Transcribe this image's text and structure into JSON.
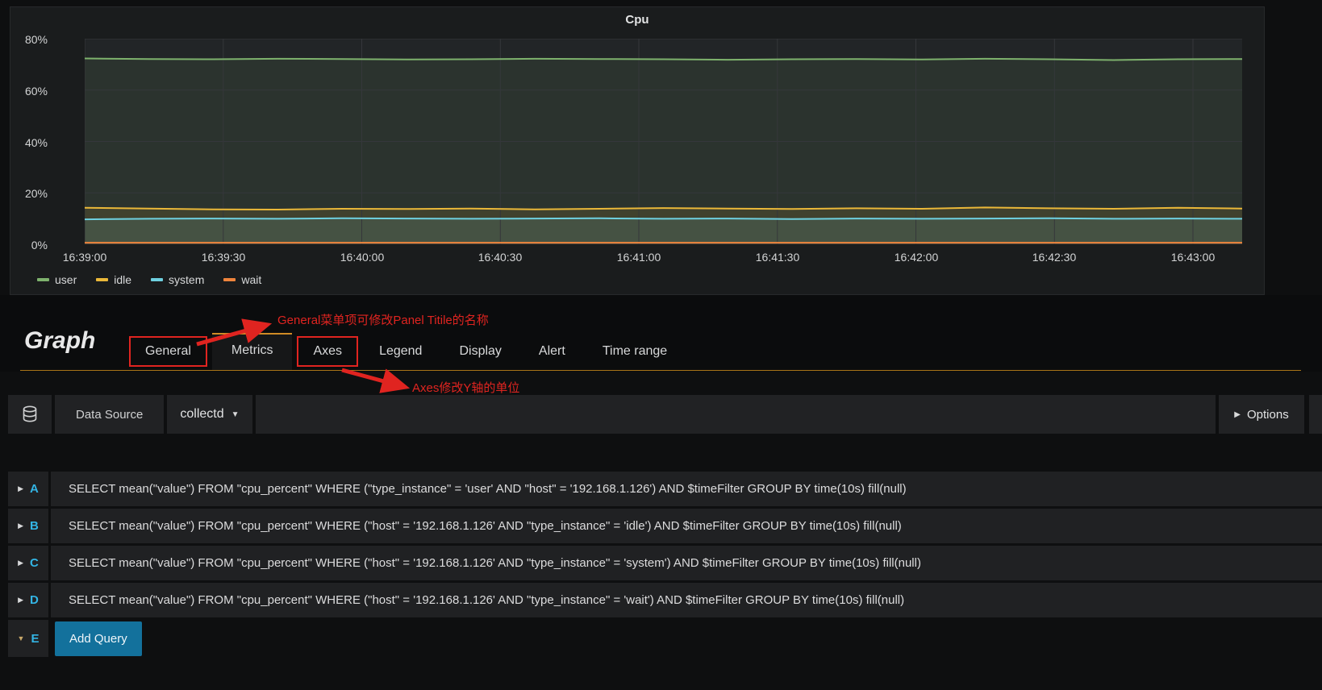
{
  "panel": {
    "title": "Cpu"
  },
  "chart_data": {
    "type": "area",
    "title": "Cpu",
    "x": [
      "16:39:00",
      "16:39:30",
      "16:40:00",
      "16:40:30",
      "16:41:00",
      "16:41:30",
      "16:42:00",
      "16:42:30",
      "16:43:00"
    ],
    "yticks": [
      "0%",
      "20%",
      "40%",
      "60%",
      "80%"
    ],
    "ylim": [
      0,
      80
    ],
    "y_unit": "percent",
    "grid": true,
    "legend_position": "bottom-left",
    "series": [
      {
        "name": "user",
        "color": "#7eb26d",
        "fill_opacity": 0.1,
        "values": [
          72.3,
          72.1,
          72.0,
          72.2,
          72.1,
          71.9,
          72.0,
          72.2,
          72.1,
          72.0,
          71.8,
          72.0,
          72.1,
          71.9,
          72.2,
          72.0,
          71.7,
          72.0,
          72.1
        ]
      },
      {
        "name": "idle",
        "color": "#eab839",
        "fill_opacity": 0.11,
        "values": [
          14.2,
          13.9,
          13.6,
          13.5,
          13.8,
          13.7,
          13.9,
          13.6,
          13.8,
          14.1,
          13.9,
          13.7,
          14.0,
          13.8,
          14.3,
          14.0,
          13.8,
          14.2,
          13.9
        ]
      },
      {
        "name": "system",
        "color": "#6ed0e0",
        "fill_opacity": 0.12,
        "values": [
          9.7,
          9.9,
          10.0,
          9.9,
          10.1,
          10.0,
          9.9,
          10.0,
          10.1,
          9.9,
          10.0,
          9.8,
          10.0,
          9.9,
          10.0,
          10.1,
          9.9,
          10.0,
          9.9
        ]
      },
      {
        "name": "wait",
        "color": "#ef843c",
        "fill_opacity": 0.06,
        "values": [
          0.6,
          0.6,
          0.6,
          0.6,
          0.6,
          0.6,
          0.6,
          0.6,
          0.6,
          0.6,
          0.6,
          0.6,
          0.6,
          0.6,
          0.6,
          0.6,
          0.6,
          0.6,
          0.6
        ]
      }
    ]
  },
  "legend": {
    "items": [
      {
        "label": "user",
        "color": "#7eb26d"
      },
      {
        "label": "idle",
        "color": "#eab839"
      },
      {
        "label": "system",
        "color": "#6ed0e0"
      },
      {
        "label": "wait",
        "color": "#ef843c"
      }
    ]
  },
  "editor": {
    "panel_type": "Graph",
    "tabs": [
      {
        "label": "General"
      },
      {
        "label": "Metrics"
      },
      {
        "label": "Axes"
      },
      {
        "label": "Legend"
      },
      {
        "label": "Display"
      },
      {
        "label": "Alert"
      },
      {
        "label": "Time range"
      }
    ],
    "annotations": {
      "general_note": "General菜单项可修改Panel Titile的名称",
      "axes_note": "Axes修改Y轴的单位",
      "color": "#e02420"
    },
    "datasource": {
      "label": "Data Source",
      "value": "collectd",
      "options_label": "Options"
    },
    "queries": [
      {
        "letter": "A",
        "text": "SELECT mean(\"value\") FROM \"cpu_percent\" WHERE (\"type_instance\" = 'user' AND \"host\" = '192.168.1.126') AND $timeFilter GROUP BY time(10s) fill(null)"
      },
      {
        "letter": "B",
        "text": "SELECT mean(\"value\") FROM \"cpu_percent\" WHERE (\"host\" = '192.168.1.126' AND \"type_instance\" = 'idle') AND $timeFilter GROUP BY time(10s) fill(null)"
      },
      {
        "letter": "C",
        "text": "SELECT mean(\"value\") FROM \"cpu_percent\" WHERE (\"host\" = '192.168.1.126' AND \"type_instance\" = 'system') AND $timeFilter GROUP BY time(10s) fill(null)"
      },
      {
        "letter": "D",
        "text": "SELECT mean(\"value\") FROM \"cpu_percent\" WHERE (\"host\" = '192.168.1.126' AND \"type_instance\" = 'wait') AND $timeFilter GROUP BY time(10s) fill(null)"
      }
    ],
    "add_row": {
      "letter": "E",
      "button_label": "Add Query"
    }
  }
}
